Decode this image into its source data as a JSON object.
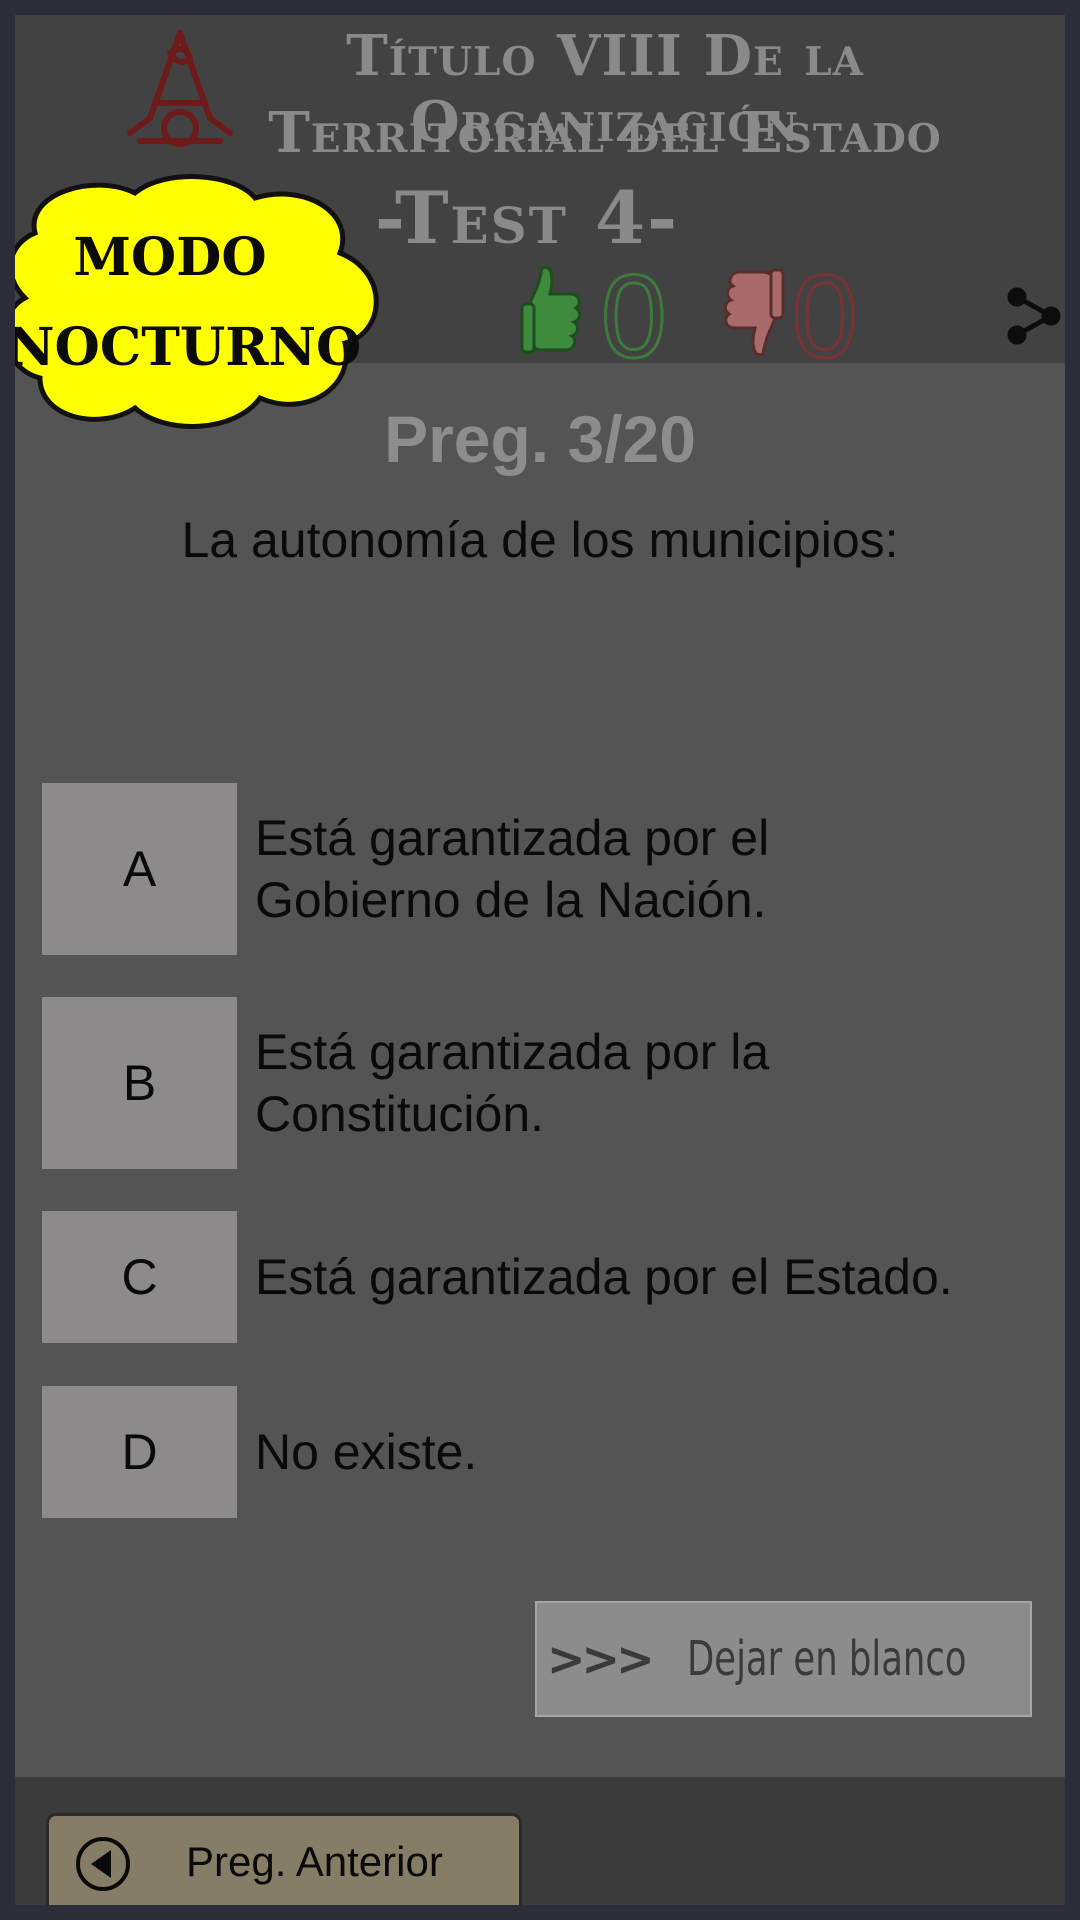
{
  "header": {
    "title_line1": "Título VIII De la Organización",
    "title_line2": "Territorial del Estado",
    "test_title": "-Test 4-",
    "correct_count": "0",
    "wrong_count": "0",
    "icons": {
      "logo": "logo-icon",
      "thumbs_up": "thumbs-up-icon",
      "thumbs_down": "thumbs-down-icon",
      "share": "share-icon"
    }
  },
  "badge": {
    "line1": "MODO",
    "line2": "NOCTURNO",
    "color": "#ffff00"
  },
  "question": {
    "counter": "Preg. 3/20",
    "text": "La autonomía de los municipios:"
  },
  "options": [
    {
      "letter": "A",
      "text": " Está garantizada por el\nGobierno de la Nación."
    },
    {
      "letter": "B",
      "text": " Está garantizada por la\nConstitución."
    },
    {
      "letter": "C",
      "text": " Está garantizada por el Estado."
    },
    {
      "letter": "D",
      "text": " No existe."
    }
  ],
  "actions": {
    "blank_arrows": ">>>",
    "blank_label": "Dejar en blanco",
    "prev_label": "Preg. Anterior"
  },
  "colors": {
    "correct": "#3d7a3d",
    "wrong": "#7a3333",
    "background": "#545454",
    "option_box": "#8c8a8b",
    "prev_button": "#857d66"
  }
}
